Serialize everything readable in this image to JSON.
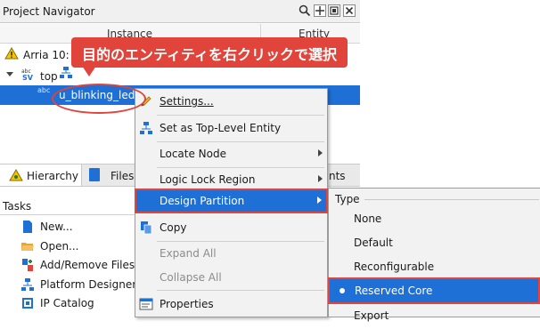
{
  "navigator": {
    "title": "Project Navigator",
    "columns": {
      "instance": "Instance",
      "entity": "Entity"
    },
    "tree": {
      "device": "Arria 10: 1",
      "top": "top",
      "selected": "u_blinking_led",
      "sv_tag": "abc sv",
      "sv_tag_small": "abc"
    },
    "tabs": {
      "hierarchy": "Hierarchy",
      "files": "Files",
      "design_units": "nts"
    }
  },
  "tasks": {
    "title": "Tasks",
    "items": [
      {
        "label": "New..."
      },
      {
        "label": "Open..."
      },
      {
        "label": "Add/Remove Files i"
      },
      {
        "label": "Platform Designer"
      },
      {
        "label": "IP Catalog"
      }
    ]
  },
  "context_menu": {
    "settings": "Settings...",
    "set_top": "Set as Top-Level Entity",
    "locate_node": "Locate Node",
    "logic_lock": "Logic Lock Region",
    "design_partition": "Design Partition",
    "copy": "Copy",
    "expand_all": "Expand All",
    "collapse_all": "Collapse All",
    "properties": "Properties"
  },
  "submenu": {
    "header": "Type",
    "none": "None",
    "default": "Default",
    "reconfigurable": "Reconfigurable",
    "reserved_core": "Reserved Core",
    "export": "Export"
  },
  "annotation": {
    "callout": "目的のエンティティを右クリックで選択"
  },
  "colors": {
    "accent_red": "#e0443a",
    "selection_blue": "#1e6fd6"
  }
}
